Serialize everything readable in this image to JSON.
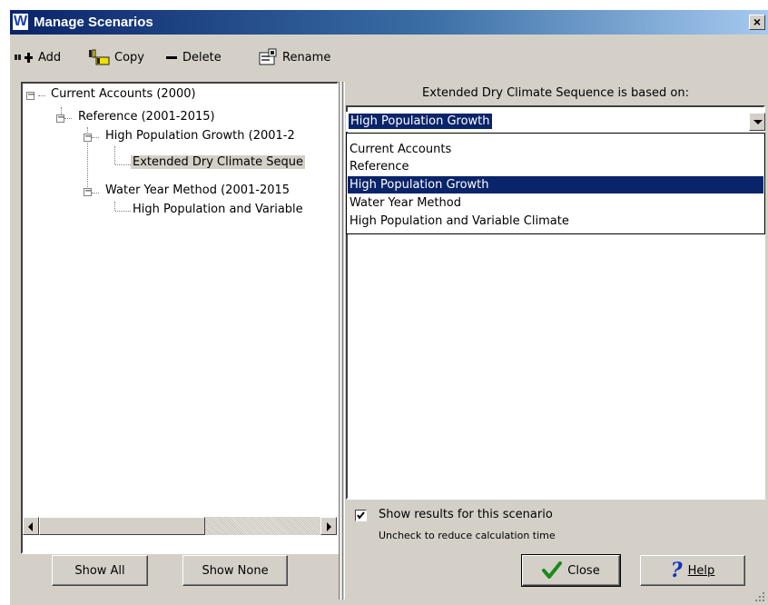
{
  "window": {
    "title": "Manage Scenarios",
    "logo_letter": "W",
    "close_glyph": "×"
  },
  "toolbar": {
    "add_label": "Add",
    "copy_label": "Copy",
    "delete_label": "Delete",
    "rename_label": "Rename"
  },
  "tree": {
    "nodes": [
      {
        "label": "Current Accounts (2000)",
        "expanded": true
      },
      {
        "label": "Reference (2001-2015)",
        "expanded": true
      },
      {
        "label": "High Population Growth (2001-2",
        "expanded": true
      },
      {
        "label": "Extended Dry Climate Seque",
        "selected": true
      },
      {
        "label": "Water Year Method (2001-2015",
        "expanded": true
      },
      {
        "label": "High Population and Variable"
      }
    ]
  },
  "based_on": {
    "heading": "Extended Dry Climate Sequence is based on:",
    "selected": "High Population Growth",
    "options": [
      "Current Accounts",
      "Reference",
      "High Population Growth",
      "Water Year Method",
      "High Population and Variable Climate"
    ]
  },
  "show_results": {
    "label": "Show results for this scenario",
    "hint": "Uncheck to reduce calculation time",
    "checked": true
  },
  "buttons": {
    "show_all": "Show All",
    "show_none": "Show None",
    "close": "Close",
    "help": "Help"
  },
  "colors": {
    "selection": "#0a246a",
    "face": "#d4d0c8"
  }
}
